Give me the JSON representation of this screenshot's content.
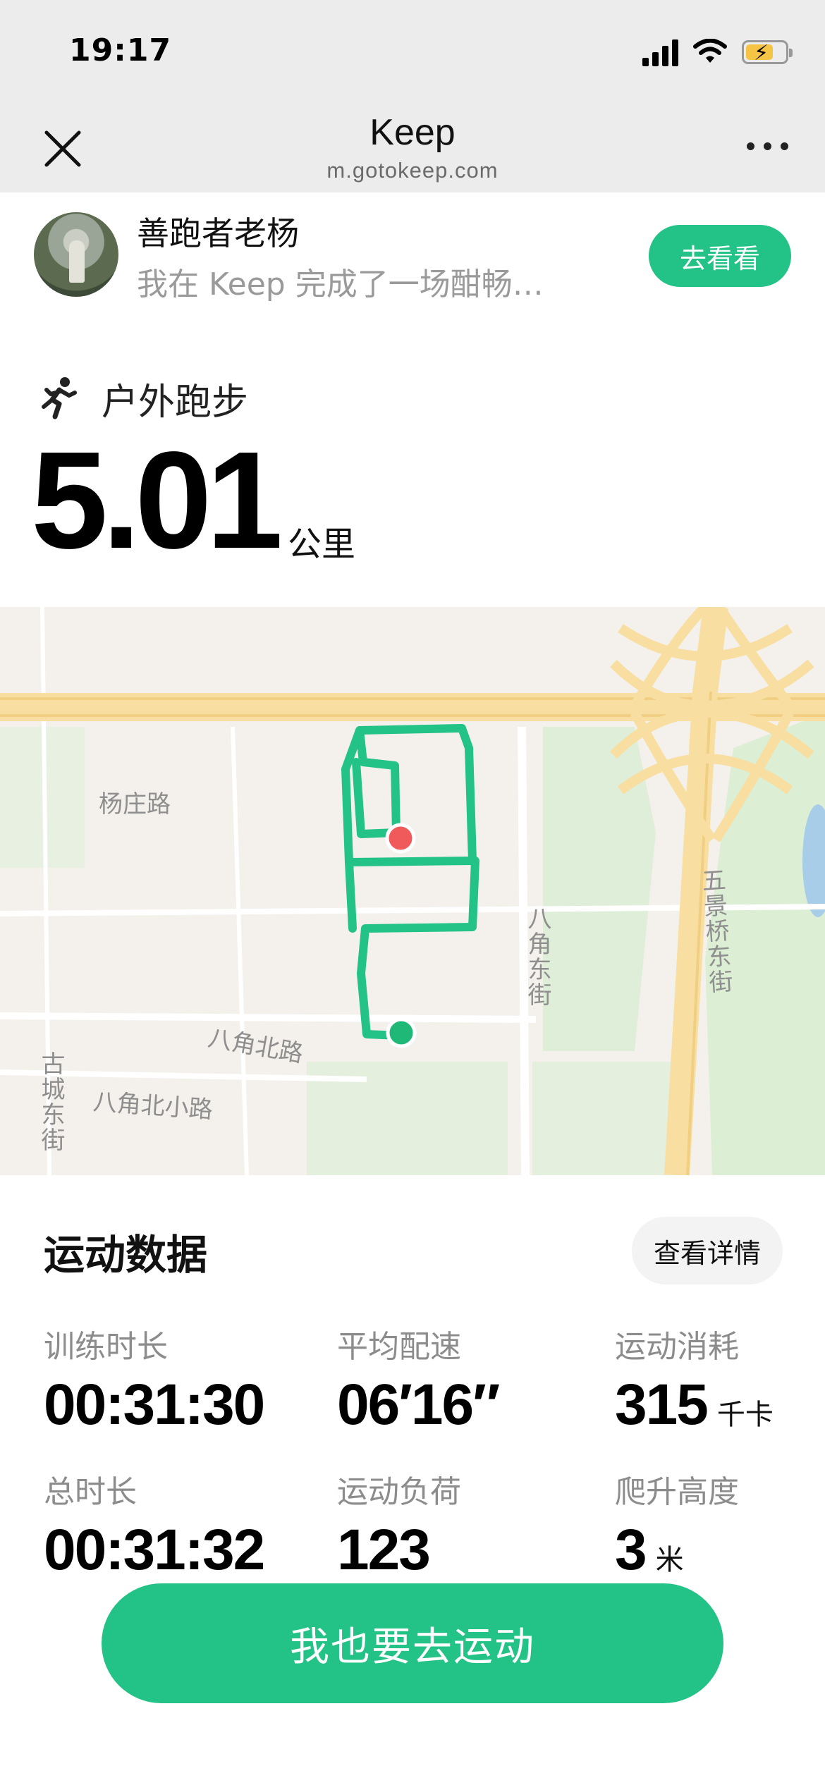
{
  "status_bar": {
    "time": "19:17"
  },
  "nav": {
    "title": "Keep",
    "url": "m.gotokeep.com"
  },
  "share": {
    "user_name": "善跑者老杨",
    "message": "我在 Keep 完成了一场酣畅…",
    "view_button": "去看看"
  },
  "activity": {
    "type": "户外跑步",
    "distance": "5.01",
    "unit": "公里"
  },
  "map": {
    "labels": {
      "yangzhuang": "杨庄路",
      "bajiao_north": "八角北路",
      "bajiao_north_small": "八角北小路",
      "bajiao_east": "八角东街",
      "gucheng_east": "古城东街",
      "wujingqiao_east": "五景桥东街"
    },
    "route_color": "#23c286",
    "start_color": "#1fb877",
    "end_color": "#f15a5a"
  },
  "stats": {
    "title": "运动数据",
    "detail_button": "查看详情",
    "items": [
      {
        "label": "训练时长",
        "value": "00:31:30",
        "unit": ""
      },
      {
        "label": "平均配速",
        "value": "06′16″",
        "unit": ""
      },
      {
        "label": "运动消耗",
        "value": "315",
        "unit": "千卡"
      },
      {
        "label": "总时长",
        "value": "00:31:32",
        "unit": ""
      },
      {
        "label": "运动负荷",
        "value": "123",
        "unit": ""
      },
      {
        "label": "爬升高度",
        "value": "3",
        "unit": "米"
      }
    ]
  },
  "cta": {
    "label": "我也要去运动"
  }
}
